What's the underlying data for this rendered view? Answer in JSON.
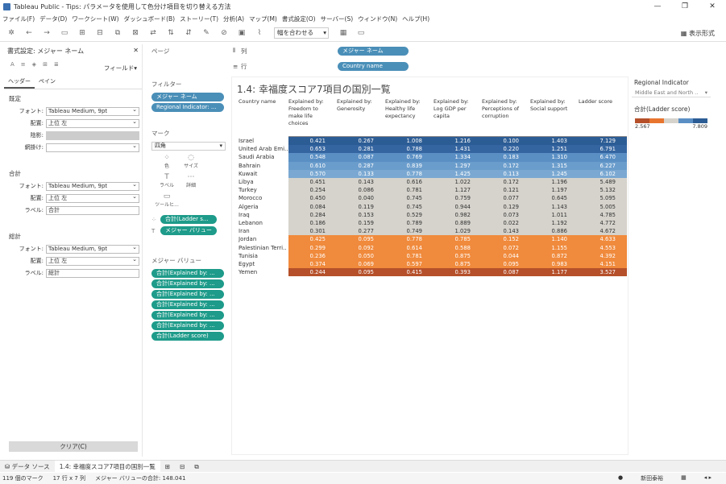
{
  "window": {
    "title": "Tableau Public - Tips: パラメータを使用して色分け項目を切り替える方法",
    "controls": [
      "—",
      "❐",
      "✕"
    ]
  },
  "menu": [
    "ファイル(F)",
    "データ(D)",
    "ワークシート(W)",
    "ダッシュボード(B)",
    "ストーリー(T)",
    "分析(A)",
    "マップ(M)",
    "書式設定(O)",
    "サーバー(S)",
    "ウィンドウ(N)",
    "ヘルプ(H)"
  ],
  "toolbar": {
    "fit_label": "幅を合わせる",
    "show_me": "表示形式"
  },
  "format_pane": {
    "title": "書式設定: メジャー ネーム",
    "field_selector": "フィールド▾",
    "tabs": [
      "ヘッダー",
      "ペイン"
    ],
    "sections": [
      {
        "heading": "既定",
        "rows": [
          {
            "label": "フォント:",
            "value": "Tableau Medium, 9pt",
            "kind": "dd"
          },
          {
            "label": "配置:",
            "value": "上位 左",
            "kind": "dd"
          },
          {
            "label": "陰影:",
            "value": "",
            "kind": "gray"
          },
          {
            "label": "網掛け:",
            "value": "",
            "kind": "dd"
          }
        ]
      },
      {
        "heading": "合計",
        "rows": [
          {
            "label": "フォント:",
            "value": "Tableau Medium, 9pt",
            "kind": "dd"
          },
          {
            "label": "配置:",
            "value": "上位 左",
            "kind": "dd"
          },
          {
            "label": "ラベル:",
            "value": "合計",
            "kind": "text"
          }
        ]
      },
      {
        "heading": "総計",
        "rows": [
          {
            "label": "フォント:",
            "value": "Tableau Medium, 9pt",
            "kind": "dd"
          },
          {
            "label": "配置:",
            "value": "上位 左",
            "kind": "dd"
          },
          {
            "label": "ラベル:",
            "value": "総計",
            "kind": "text"
          }
        ]
      }
    ],
    "clear_label": "クリア(C)"
  },
  "pages_label": "ページ",
  "filters": {
    "label": "フィルター",
    "pills": [
      "メジャー ネーム",
      "Regional Indicator: ..."
    ]
  },
  "marks": {
    "label": "マーク",
    "type": "四角",
    "buttons": [
      {
        "icon": "⁘",
        "label": "色"
      },
      {
        "icon": "◌",
        "label": "サイズ"
      },
      {
        "icon": "T",
        "label": "ラベル"
      },
      {
        "icon": "⋯",
        "label": "詳細"
      },
      {
        "icon": "▭",
        "label": "ツールヒ..."
      }
    ],
    "detail_pills": [
      "合計(Ladder s...",
      "メジャー バリュー"
    ]
  },
  "measure_values": {
    "label": "メジャー バリュー",
    "pills": [
      "合計(Explained by: ...",
      "合計(Explained by: ...",
      "合計(Explained by: ...",
      "合計(Explained by: ...",
      "合計(Explained by: ...",
      "合計(Explained by: ...",
      "合計(Ladder score)"
    ]
  },
  "shelves": {
    "columns_label": "列",
    "columns_pill": "メジャー ネーム",
    "rows_label": "行",
    "rows_pill": "Country name"
  },
  "view": {
    "title": "1.4: 幸福度スコア7項目の国別一覧",
    "row_header": "Country name",
    "columns": [
      "Explained by: Freedom to make life choices",
      "Explained by: Generosity",
      "Explained by: Healthy life expectancy",
      "Explained by: Log GDP per capita",
      "Explained by: Perceptions of corruption",
      "Explained by: Social support",
      "Ladder score"
    ],
    "rows": [
      {
        "country": "Israel",
        "values": [
          "0.421",
          "0.267",
          "1.008",
          "1.216",
          "0.100",
          "1.403",
          "7.129"
        ],
        "color": "#2c5c94"
      },
      {
        "country": "United Arab Emi..",
        "values": [
          "0.653",
          "0.281",
          "0.788",
          "1.431",
          "0.220",
          "1.251",
          "6.791"
        ],
        "color": "#3565a0"
      },
      {
        "country": "Saudi Arabia",
        "values": [
          "0.548",
          "0.087",
          "0.769",
          "1.334",
          "0.183",
          "1.310",
          "6.470"
        ],
        "color": "#5a8fc4"
      },
      {
        "country": "Bahrain",
        "values": [
          "0.610",
          "0.287",
          "0.839",
          "1.297",
          "0.172",
          "1.315",
          "6.227"
        ],
        "color": "#6b9dcc"
      },
      {
        "country": "Kuwait",
        "values": [
          "0.570",
          "0.133",
          "0.778",
          "1.425",
          "0.113",
          "1.245",
          "6.102"
        ],
        "color": "#7aa8d2"
      },
      {
        "country": "Libya",
        "values": [
          "0.451",
          "0.143",
          "0.616",
          "1.022",
          "0.172",
          "1.196",
          "5.489"
        ],
        "color": "#d6d3cc"
      },
      {
        "country": "Turkey",
        "values": [
          "0.254",
          "0.086",
          "0.781",
          "1.127",
          "0.121",
          "1.197",
          "5.132"
        ],
        "color": "#d6d3cc"
      },
      {
        "country": "Morocco",
        "values": [
          "0.450",
          "0.040",
          "0.745",
          "0.759",
          "0.077",
          "0.645",
          "5.095"
        ],
        "color": "#d6d3cc"
      },
      {
        "country": "Algeria",
        "values": [
          "0.084",
          "0.119",
          "0.745",
          "0.944",
          "0.129",
          "1.143",
          "5.005"
        ],
        "color": "#d6d3cc"
      },
      {
        "country": "Iraq",
        "values": [
          "0.284",
          "0.153",
          "0.529",
          "0.982",
          "0.073",
          "1.011",
          "4.785"
        ],
        "color": "#d6d3cc"
      },
      {
        "country": "Lebanon",
        "values": [
          "0.186",
          "0.159",
          "0.789",
          "0.889",
          "0.022",
          "1.192",
          "4.772"
        ],
        "color": "#d6d3cc"
      },
      {
        "country": "Iran",
        "values": [
          "0.301",
          "0.277",
          "0.749",
          "1.029",
          "0.143",
          "0.886",
          "4.672"
        ],
        "color": "#d6d3cc"
      },
      {
        "country": "Jordan",
        "values": [
          "0.425",
          "0.095",
          "0.778",
          "0.785",
          "0.152",
          "1.140",
          "4.633"
        ],
        "color": "#f08a3c"
      },
      {
        "country": "Palestinian Terri..",
        "values": [
          "0.299",
          "0.092",
          "0.614",
          "0.588",
          "0.072",
          "1.155",
          "4.553"
        ],
        "color": "#f08a3c"
      },
      {
        "country": "Tunisia",
        "values": [
          "0.236",
          "0.050",
          "0.781",
          "0.875",
          "0.044",
          "0.872",
          "4.392"
        ],
        "color": "#f08a3c"
      },
      {
        "country": "Egypt",
        "values": [
          "0.374",
          "0.069",
          "0.597",
          "0.875",
          "0.095",
          "0.983",
          "4.151"
        ],
        "color": "#f08a3c"
      },
      {
        "country": "Yemen",
        "values": [
          "0.244",
          "0.095",
          "0.415",
          "0.393",
          "0.087",
          "1.177",
          "3.527"
        ],
        "color": "#b5502a"
      }
    ]
  },
  "right_pane": {
    "filter_title": "Regional Indicator",
    "filter_value": "Middle East and North ..",
    "legend_title": "合計(Ladder score)",
    "legend_min": "2.567",
    "legend_max": "7.809",
    "legend_colors": [
      "#b5502a",
      "#e8752e",
      "#d6d3cc",
      "#5a8fc4",
      "#2c5c94"
    ]
  },
  "tabs": {
    "data_source": "データ ソース",
    "sheet": "1.4: 幸福度スコア7項目の国別一覧"
  },
  "status": {
    "marks": "119 個のマーク",
    "rows_cols": "17 行 x 7 列",
    "sum": "メジャー バリューの合計: 148.041",
    "right_label": "新田泰裕"
  }
}
